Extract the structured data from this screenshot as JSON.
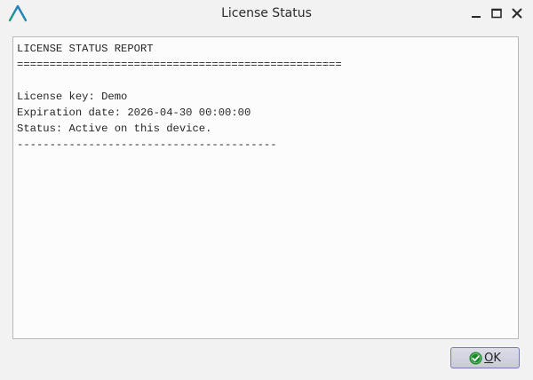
{
  "window": {
    "title": "License Status",
    "logo_icon": "app-logo-icon",
    "controls": {
      "minimize_icon": "minimize-icon",
      "maximize_icon": "maximize-icon",
      "close_icon": "close-icon"
    }
  },
  "report": {
    "lines": [
      "LICENSE STATUS REPORT",
      "==================================================",
      "",
      "License key: Demo",
      "Expiration date: 2026-04-30 00:00:00",
      "Status: Active on this device.",
      "----------------------------------------"
    ]
  },
  "ok_button": {
    "mnemonic": "O",
    "label_rest": "K",
    "icon": "check-circle-icon",
    "icon_color": "#1a8a2a"
  },
  "colors": {
    "logo_green": "#1aa37a",
    "logo_blue": "#2a6fdb"
  }
}
